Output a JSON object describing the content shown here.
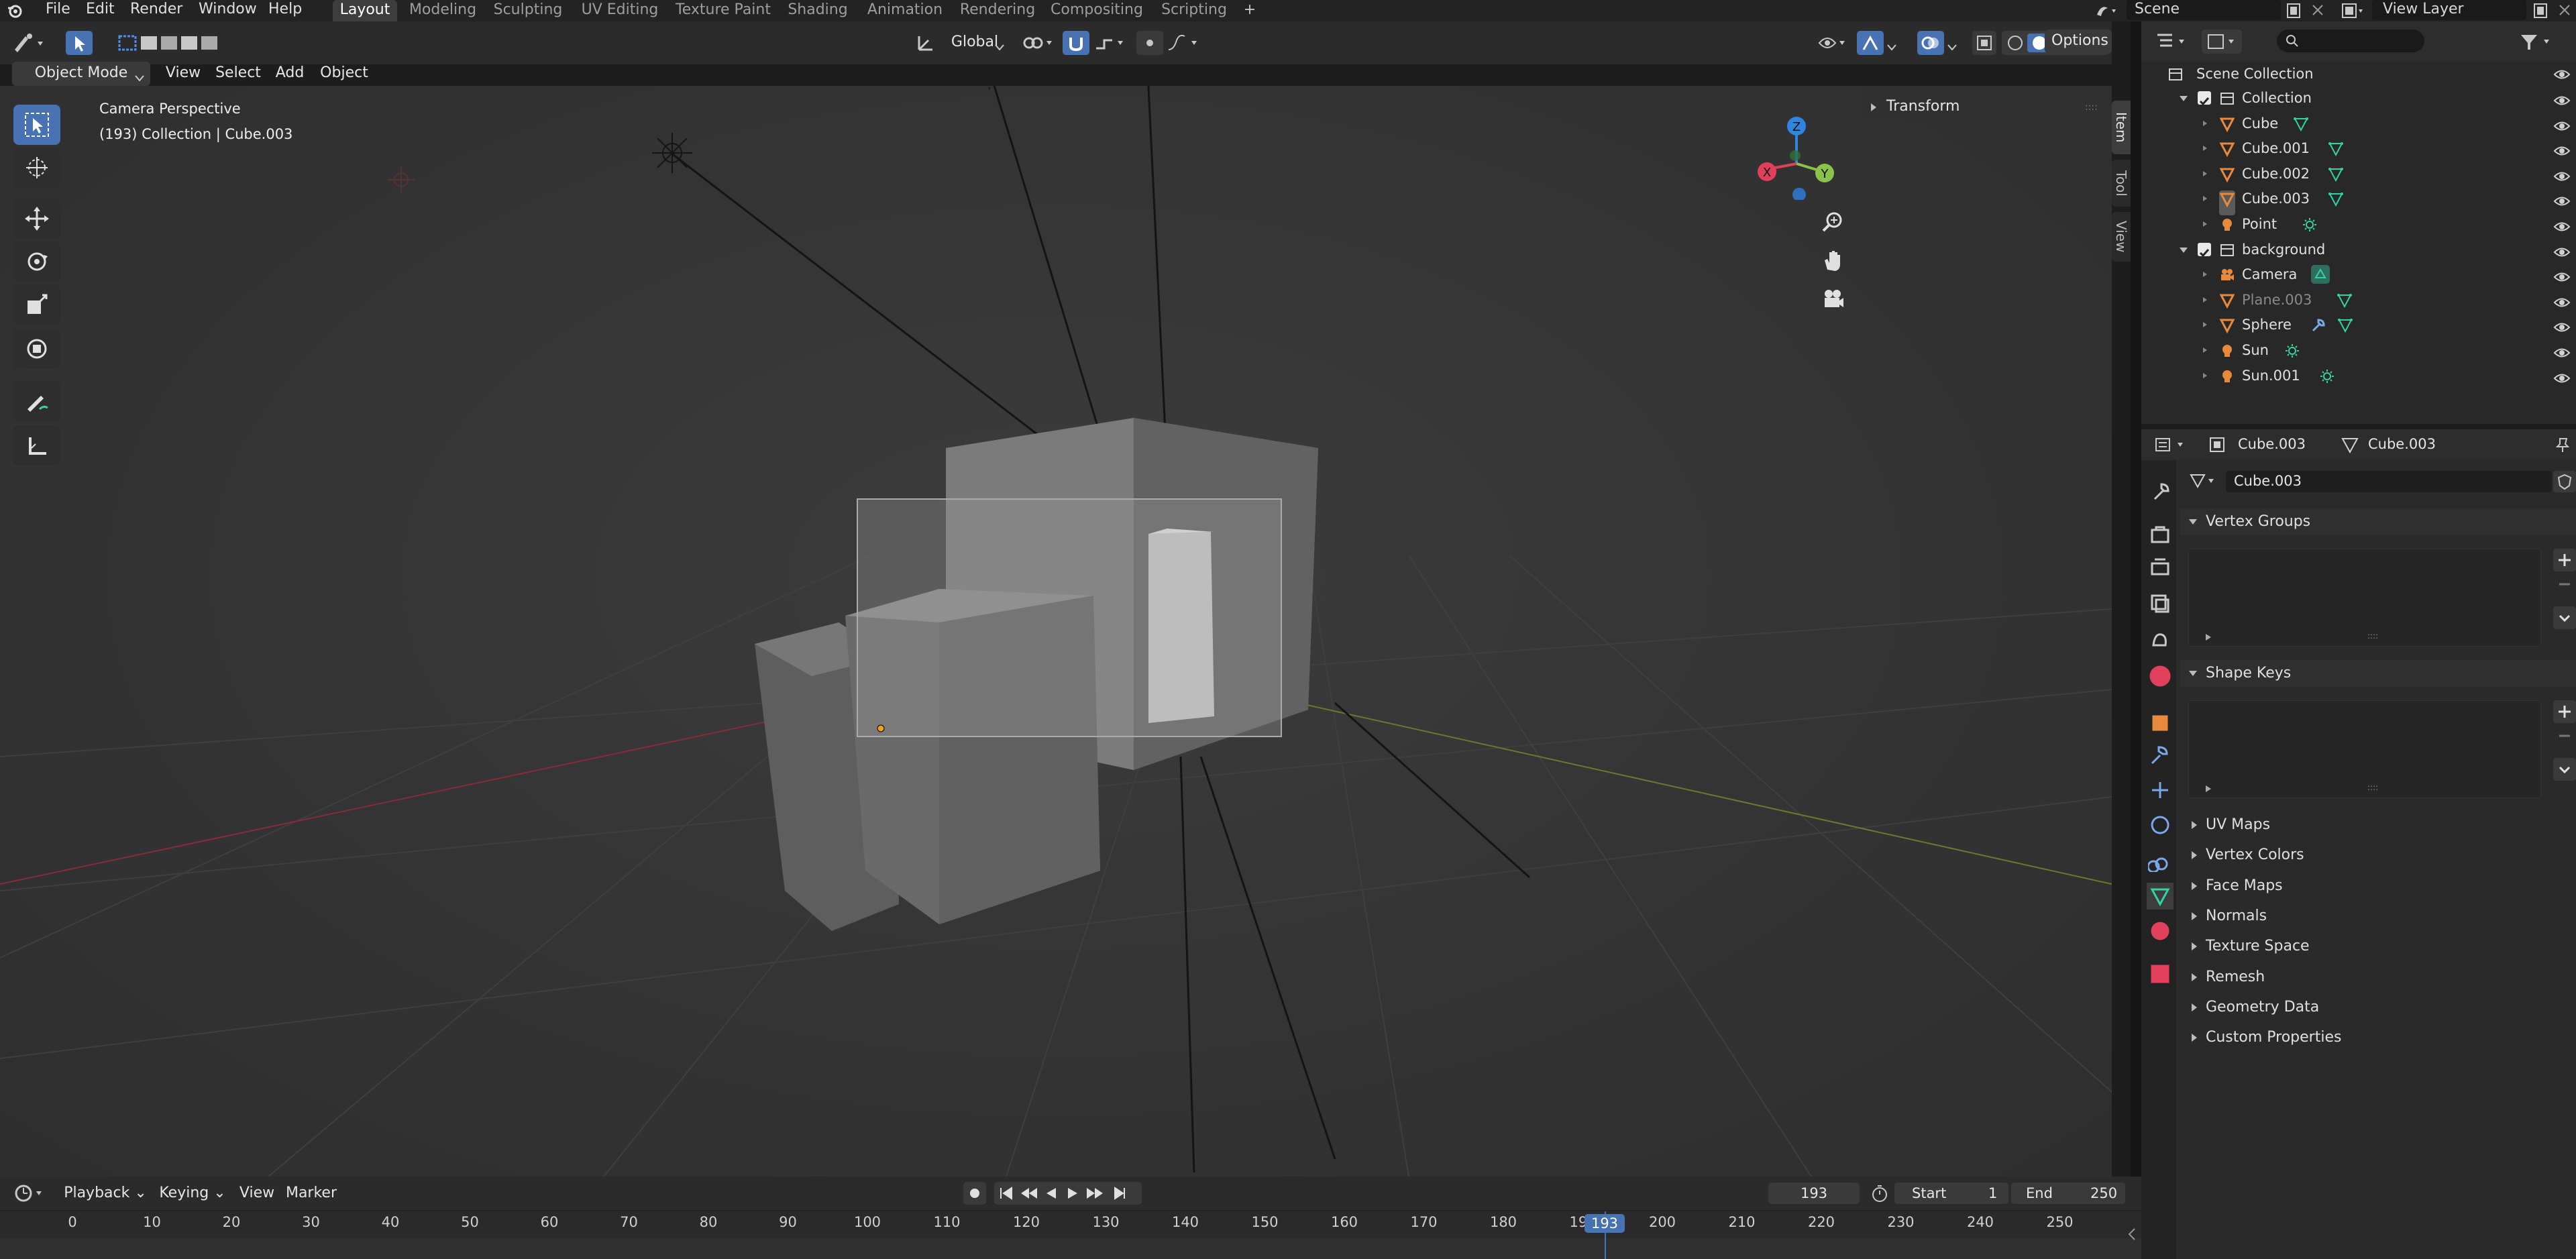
{
  "topbar": {
    "menus": [
      "File",
      "Edit",
      "Render",
      "Window",
      "Help"
    ],
    "workspaces": [
      "Layout",
      "Modeling",
      "Sculpting",
      "UV Editing",
      "Texture Paint",
      "Shading",
      "Animation",
      "Rendering",
      "Compositing",
      "Scripting"
    ],
    "add_tab": "+",
    "scene_label": "Scene",
    "view_layer_label": "View Layer"
  },
  "viewport_header": {
    "mode": "Object Mode",
    "menus": [
      "View",
      "Select",
      "Add",
      "Object"
    ],
    "transform_orientation": "Global",
    "options_label": "Options"
  },
  "viewport": {
    "perspective_label": "Camera Perspective",
    "collection_label": "(193) Collection | Cube.003",
    "transform_panel": "Transform",
    "side_tabs": [
      "Item",
      "Tool",
      "View"
    ],
    "gizmo": {
      "z": "Z",
      "y": "Y",
      "x": "X"
    }
  },
  "outliner": {
    "root": "Scene Collection",
    "items": [
      {
        "label": "Collection",
        "type": "collection"
      },
      {
        "label": "Cube",
        "type": "mesh"
      },
      {
        "label": "Cube.001",
        "type": "mesh"
      },
      {
        "label": "Cube.002",
        "type": "mesh"
      },
      {
        "label": "Cube.003",
        "type": "mesh"
      },
      {
        "label": "Point",
        "type": "light"
      },
      {
        "label": "background",
        "type": "collection"
      },
      {
        "label": "Camera",
        "type": "camera"
      },
      {
        "label": "Plane.003",
        "type": "mesh"
      },
      {
        "label": "Sphere",
        "type": "mesh"
      },
      {
        "label": "Sun",
        "type": "light"
      },
      {
        "label": "Sun.001",
        "type": "light"
      }
    ]
  },
  "properties": {
    "breadcrumb_object": "Cube.003",
    "breadcrumb_data": "Cube.003",
    "datablock_name": "Cube.003",
    "panels_open": [
      "Vertex Groups",
      "Shape Keys"
    ],
    "panels_closed": [
      "UV Maps",
      "Vertex Colors",
      "Face Maps",
      "Normals",
      "Texture Space",
      "Remesh",
      "Geometry Data",
      "Custom Properties"
    ],
    "list_dots": "::::"
  },
  "timeline": {
    "menus": [
      "Playback",
      "Keying",
      "View",
      "Marker"
    ],
    "current_frame": "193",
    "start_label": "Start",
    "start_value": "1",
    "end_label": "End",
    "end_value": "250",
    "ruler": [
      "0",
      "10",
      "20",
      "30",
      "40",
      "50",
      "60",
      "70",
      "80",
      "90",
      "100",
      "110",
      "120",
      "130",
      "140",
      "150",
      "160",
      "170",
      "180",
      "190",
      "200",
      "210",
      "220",
      "230",
      "240",
      "250"
    ],
    "playhead_label": "193"
  },
  "colors": {
    "accent": "#4772b3",
    "mesh_icon": "#e8893c",
    "data_icon": "#33d3a4",
    "x_axis": "#e0405b",
    "y_axis": "#8bc34a",
    "z_axis": "#2f85e0"
  }
}
